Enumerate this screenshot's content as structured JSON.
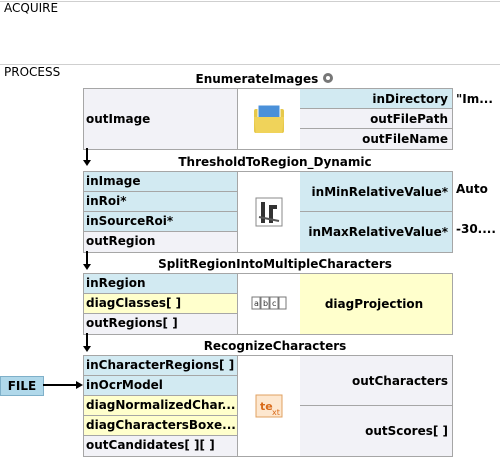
{
  "sections": {
    "acquire": "ACQUIRE",
    "process": "PROCESS"
  },
  "blocks": [
    {
      "title": "EnumerateImages",
      "title_icon": "gear-icon",
      "inputs_left": [
        "outImage"
      ],
      "icon": "folder-images-icon",
      "right": [
        "inDirectory",
        "outFilePath",
        "outFileName"
      ],
      "values": [
        "\"Im..."
      ]
    },
    {
      "title": "ThresholdToRegion_Dynamic",
      "inputs_left": [
        "inImage",
        "inRoi*",
        "inSourceRoi*",
        "outRegion"
      ],
      "icon": "threshold-icon",
      "right": [
        "inMinRelativeValue*",
        "inMaxRelativeValue*"
      ],
      "values": [
        "Auto",
        "-30...."
      ]
    },
    {
      "title": "SplitRegionIntoMultipleCharacters",
      "inputs_left": [
        "inRegion",
        "diagClasses[ ]",
        "outRegions[ ]"
      ],
      "icon": "split-characters-icon",
      "right": [
        "diagProjection"
      ]
    },
    {
      "title": "RecognizeCharacters",
      "inputs_left": [
        "inCharacterRegions[ ]",
        "inOcrModel",
        "diagNormalizedChar...",
        "diagCharactersBoxe...",
        "outCandidates[ ][ ]"
      ],
      "icon": "recognize-text-icon",
      "right": [
        "outCharacters",
        "outScores[ ]"
      ]
    }
  ],
  "file_input": "FILE"
}
